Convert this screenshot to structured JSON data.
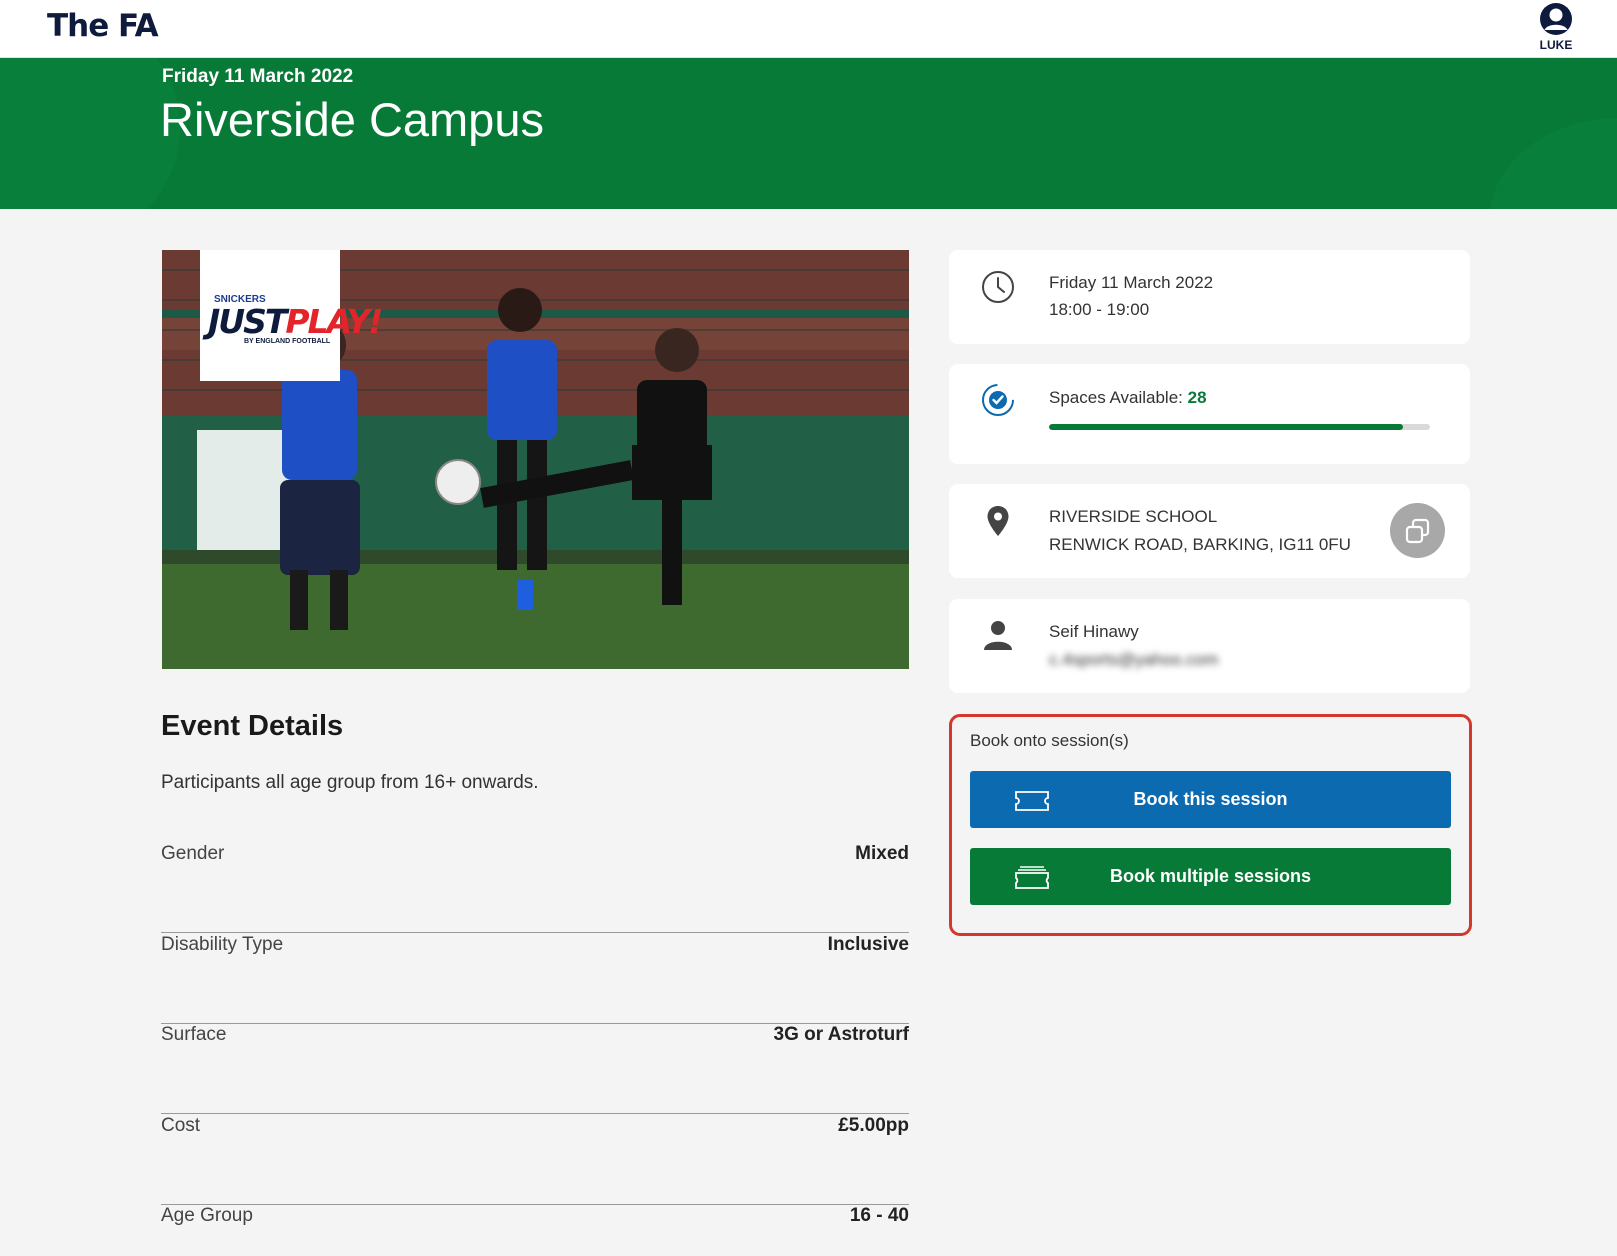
{
  "header": {
    "logo": "The FA",
    "user_label": "LUKE"
  },
  "hero": {
    "date": "Friday 11 March 2022",
    "title": "Riverside Campus"
  },
  "badge": {
    "sponsor": "SNICKERS",
    "brand_main": "JUST",
    "brand_accent": "PLAY!",
    "tagline": "BY ENGLAND FOOTBALL"
  },
  "event_details": {
    "title": "Event Details",
    "description": "Participants all age group from 16+ onwards.",
    "rows": [
      {
        "label": "Gender",
        "value": "Mixed"
      },
      {
        "label": "Disability Type",
        "value": "Inclusive"
      },
      {
        "label": "Surface",
        "value": "3G or Astroturf"
      },
      {
        "label": "Cost",
        "value": "£5.00pp"
      },
      {
        "label": "Age Group",
        "value": "16 - 40"
      }
    ]
  },
  "cards": {
    "datetime": {
      "date": "Friday 11 March 2022",
      "time": "18:00 - 19:00"
    },
    "spaces": {
      "label": "Spaces Available: ",
      "count": "28",
      "fill_fraction": 0.93
    },
    "location": {
      "venue": "RIVERSIDE SCHOOL",
      "address": "RENWICK ROAD, BARKING, IG11 0FU"
    },
    "contact": {
      "name": "Seif Hinawy",
      "email": "c.4sports@yahoo.com"
    }
  },
  "booking": {
    "label": "Book onto session(s)",
    "single_label": "Book this session",
    "multi_label": "Book multiple sessions"
  },
  "colors": {
    "brand_green": "#087a37",
    "brand_blue": "#0b6ab0",
    "navy": "#0e1b3d",
    "highlight_red": "#d4372c"
  },
  "icons": [
    "user-icon",
    "clock-icon",
    "spaces-check-icon",
    "location-pin-icon",
    "copy-icon",
    "person-icon",
    "ticket-icon",
    "tickets-stack-icon"
  ]
}
